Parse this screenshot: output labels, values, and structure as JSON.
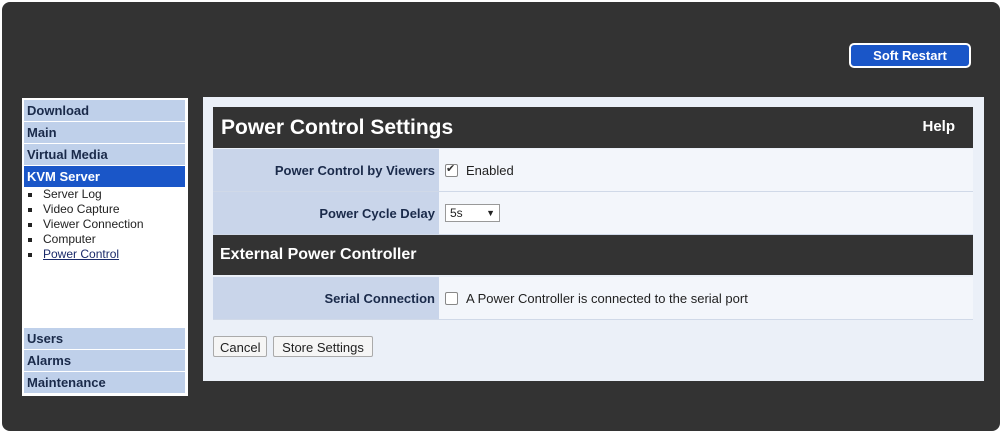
{
  "header": {
    "soft_restart_label": "Soft Restart"
  },
  "sidebar": {
    "top_items": [
      {
        "label": "Download"
      },
      {
        "label": "Main"
      },
      {
        "label": "Virtual Media"
      },
      {
        "label": "KVM Server"
      }
    ],
    "sub_items": [
      {
        "label": "Server Log"
      },
      {
        "label": "Video Capture"
      },
      {
        "label": "Viewer Connection"
      },
      {
        "label": "Computer"
      },
      {
        "label": "Power Control"
      }
    ],
    "bottom_items": [
      {
        "label": "Users"
      },
      {
        "label": "Alarms"
      },
      {
        "label": "Maintenance"
      }
    ]
  },
  "main": {
    "title": "Power Control Settings",
    "help_label": "Help",
    "power_control_by_viewers": {
      "label": "Power Control by Viewers",
      "checkbox_label": "Enabled",
      "checked": true
    },
    "power_cycle_delay": {
      "label": "Power Cycle Delay",
      "value": "5s"
    },
    "section_external": "External Power Controller",
    "serial_connection": {
      "label": "Serial Connection",
      "checkbox_label": "A Power Controller is connected to the serial port",
      "checked": false
    },
    "cancel_label": "Cancel",
    "store_label": "Store Settings"
  },
  "colors": {
    "accent": "#1a56c8",
    "nav_bg": "#bfd0ea",
    "header_bg": "#333333"
  }
}
